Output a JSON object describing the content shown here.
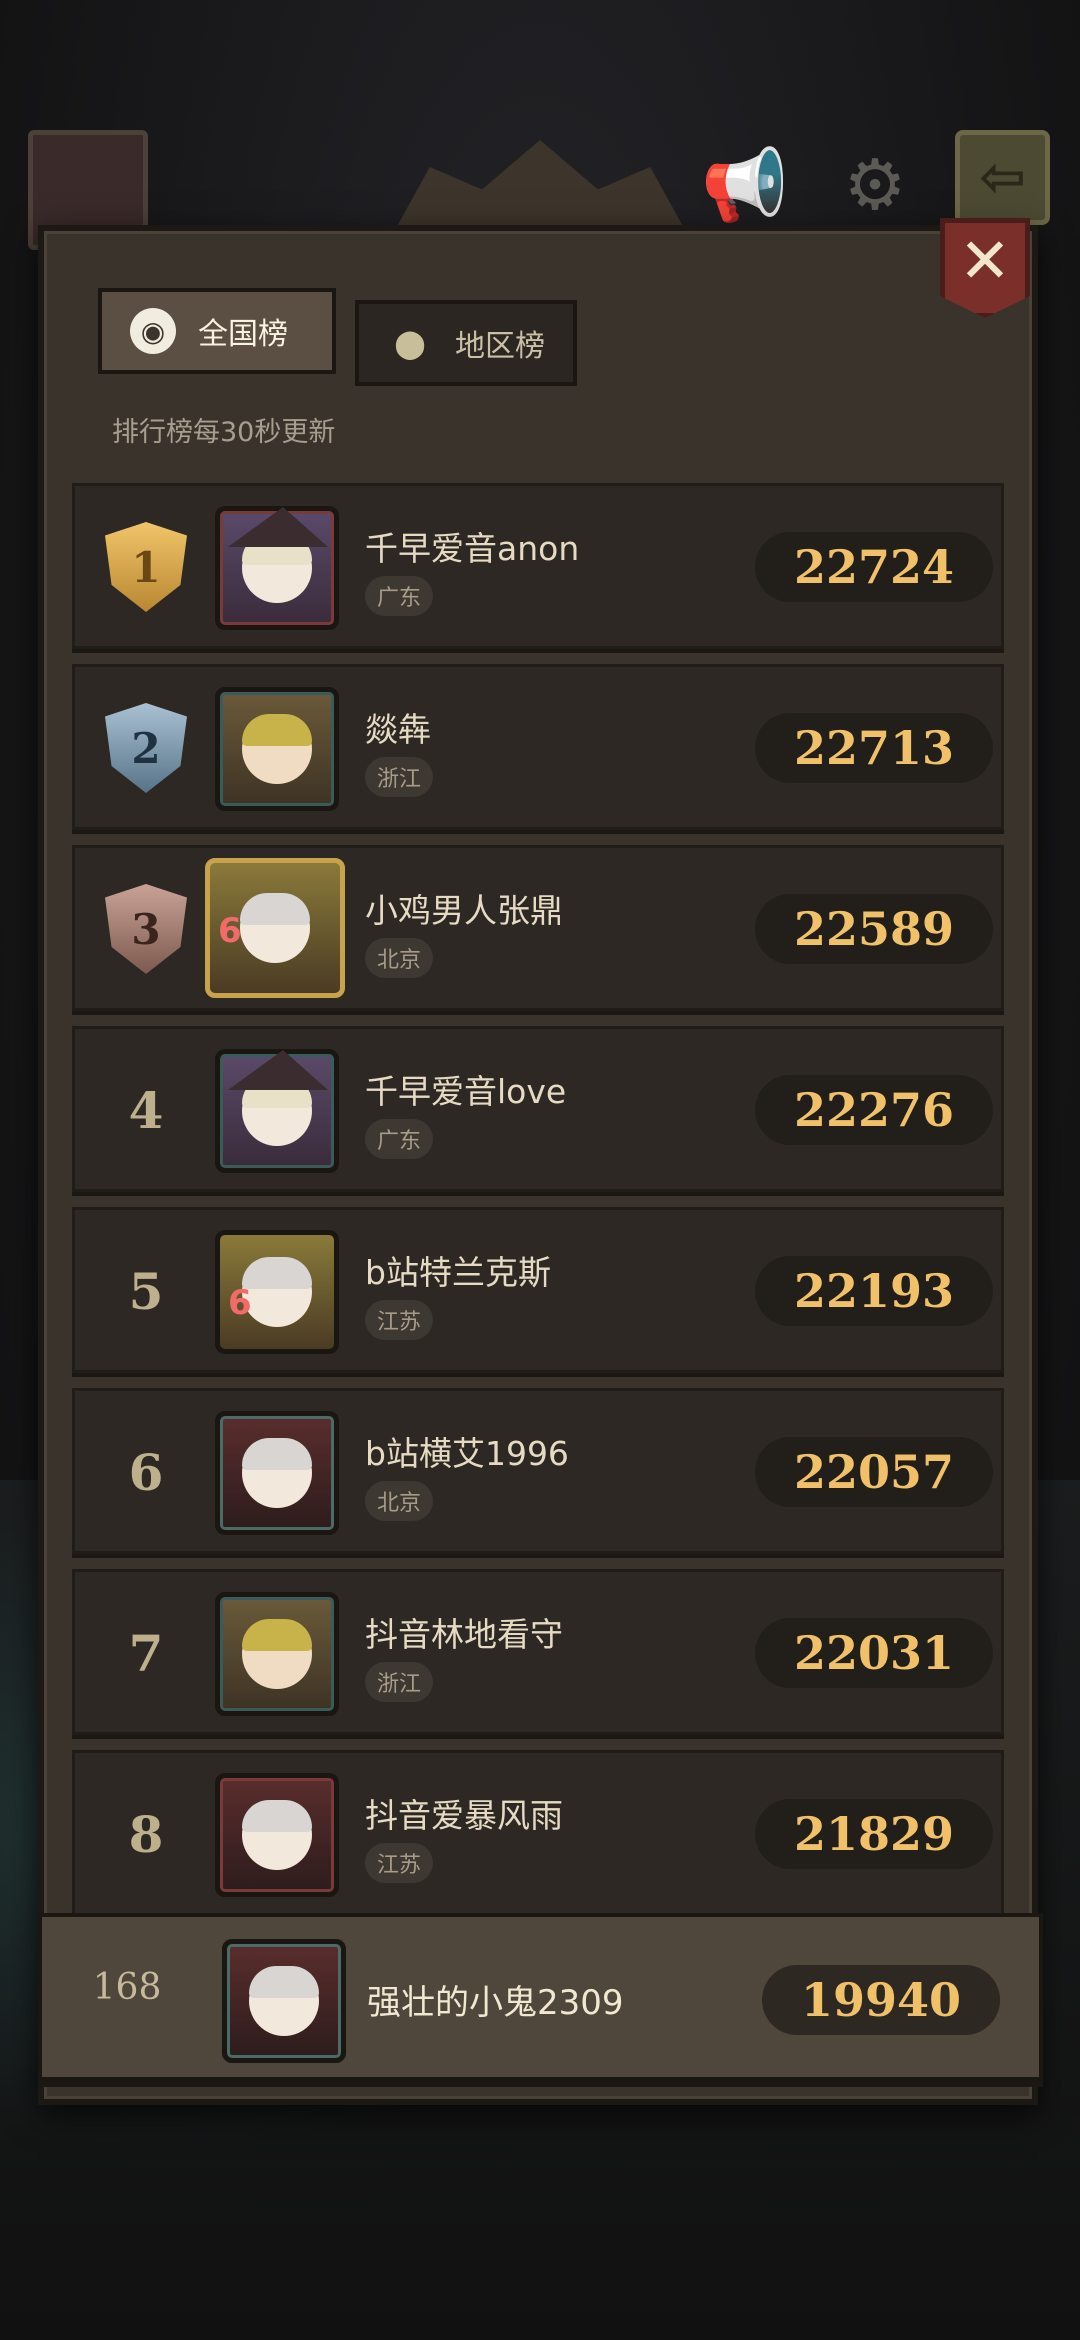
{
  "tabs": {
    "national": {
      "label": "全国榜",
      "icon": "globe-icon"
    },
    "regional": {
      "label": "地区榜",
      "icon": "location-pin-icon"
    }
  },
  "update_note": "排行榜每30秒更新",
  "rows": [
    {
      "rank": "1",
      "name": "千早爱音anon",
      "region": "广东",
      "score": "22724"
    },
    {
      "rank": "2",
      "name": "燚犇",
      "region": "浙江",
      "score": "22713"
    },
    {
      "rank": "3",
      "name": "小鸡男人张鼎",
      "region": "北京",
      "score": "22589"
    },
    {
      "rank": "4",
      "name": "千早爱音love",
      "region": "广东",
      "score": "22276"
    },
    {
      "rank": "5",
      "name": "b站特兰克斯",
      "region": "江苏",
      "score": "22193"
    },
    {
      "rank": "6",
      "name": "b站横艾1996",
      "region": "北京",
      "score": "22057"
    },
    {
      "rank": "7",
      "name": "抖音林地看守",
      "region": "浙江",
      "score": "22031"
    },
    {
      "rank": "8",
      "name": "抖音爱暴风雨",
      "region": "江苏",
      "score": "21829"
    }
  ],
  "me": {
    "rank": "168",
    "name": "强壮的小鬼2309",
    "score": "19940"
  },
  "colors": {
    "score_gold": "#f0c168",
    "panel": "#3a332c",
    "close_red": "#7a2f2b"
  }
}
